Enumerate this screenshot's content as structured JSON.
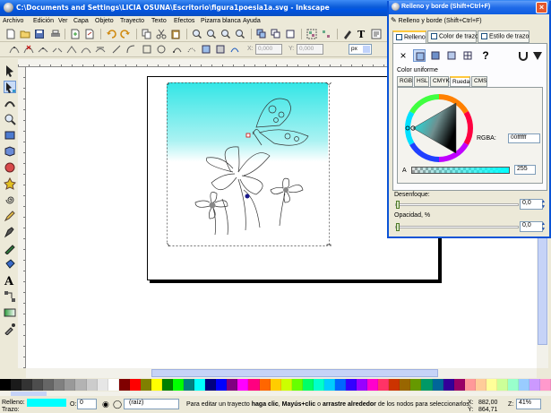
{
  "window": {
    "title": "C:\\Documents and Settings\\LICIA OSUNA\\Escritorio\\figura1poesia1a.svg - Inkscape"
  },
  "menu": [
    "Archivo",
    "Edición",
    "Ver",
    "Capa",
    "Objeto",
    "Trayecto",
    "Texto",
    "Efectos",
    "Pizarra blanca",
    "Ayuda"
  ],
  "toolbar2": {
    "x_label": "X:",
    "x_value": "0,000",
    "y_label": "Y:",
    "y_value": "0,000",
    "unit": "px"
  },
  "dialog": {
    "title": "Relleno y borde (Shift+Ctrl+F)",
    "tab_title": "Relleno y borde (Shift+Ctrl+F)",
    "tabs": [
      "Relleno",
      "Color de trazo",
      "Estilo de trazo"
    ],
    "active_tab": "Relleno",
    "paint_type_label": "Color uniforme",
    "color_modes": [
      "RGB",
      "HSL",
      "CMYK",
      "Rueda",
      "CMS"
    ],
    "active_color_mode": "Rueda",
    "alpha_label": "A",
    "alpha_value": "255",
    "rgba_label": "RGBA:",
    "rgba_value": "00ffffff",
    "blur_label": "Desenfoque:",
    "blur_value": "0,0",
    "opacity_label": "Opacidad, %",
    "opacity_value": "0,0",
    "fill_color": "#00ffff"
  },
  "status": {
    "fill_label": "Relleno:",
    "stroke_label": "Trazo:",
    "opacity_label": "O:",
    "opacity_value": "0",
    "layer": "(raíz)",
    "message_pre": "Para editar un trayecto ",
    "message_b1": "haga clic",
    "message_mid": ", ",
    "message_b2": "Mayús+clic",
    "message_mid2": " o ",
    "message_b3": "arrastre alrededor",
    "message_post": " de los nodos para seleccionarlos,",
    "x_label": "X:",
    "x_value": "882,00",
    "y_label": "Y:",
    "y_value": "864,71",
    "zoom_label": "Z:",
    "zoom_value": "41%"
  },
  "palette": [
    "#000000",
    "#1a1a1a",
    "#333333",
    "#4d4d4d",
    "#666666",
    "#808080",
    "#999999",
    "#b3b3b3",
    "#cccccc",
    "#e6e6e6",
    "#ffffff",
    "#800000",
    "#ff0000",
    "#808000",
    "#ffff00",
    "#008000",
    "#00ff00",
    "#008080",
    "#00ffff",
    "#000080",
    "#0000ff",
    "#800080",
    "#ff00ff",
    "#ff0080",
    "#ff6600",
    "#ffcc00",
    "#ccff00",
    "#66ff00",
    "#00ff66",
    "#00ffcc",
    "#00ccff",
    "#0066ff",
    "#3300ff",
    "#9900ff",
    "#ff00cc",
    "#ff3366",
    "#cc3300",
    "#996600",
    "#669900",
    "#009966",
    "#006699",
    "#330099",
    "#990066",
    "#ff9999",
    "#ffcc99",
    "#ffff99",
    "#ccff99",
    "#99ffcc",
    "#99ccff",
    "#cc99ff",
    "#ff99cc"
  ]
}
